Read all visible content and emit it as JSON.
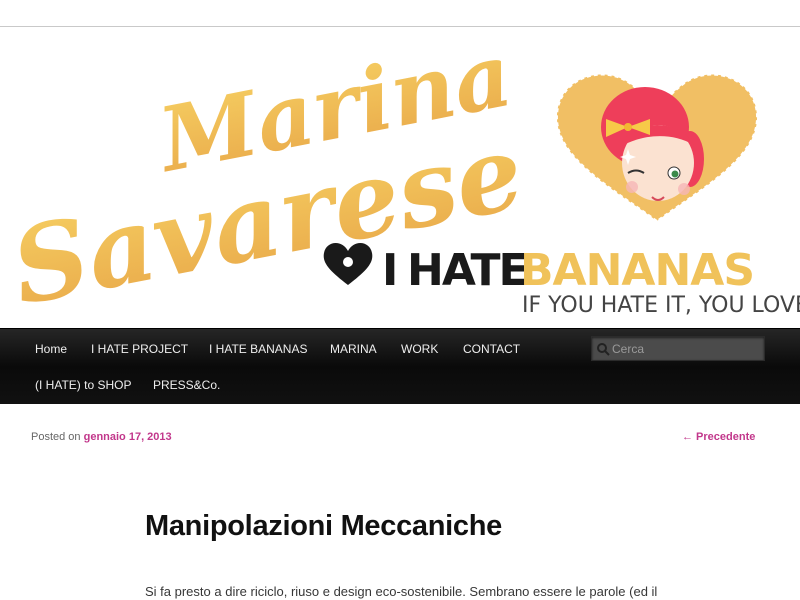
{
  "header": {
    "brand_first": "Marina",
    "brand_last": "Savarese",
    "logo_i": "I",
    "logo_hate": "HATE",
    "logo_bananas": "BANANAS",
    "tagline": "IF YOU HATE IT, YOU LOVE IT",
    "colors": {
      "brand_yellow": "#f0c25a",
      "heart_fill": "#f1bf64",
      "hair": "#ee3e5a",
      "dark": "#1a1a1a"
    }
  },
  "nav": {
    "items_row1": [
      "Home",
      "I HATE PROJECT",
      "I HATE BANANAS",
      "MARINA",
      "WORK",
      "CONTACT"
    ],
    "items_row2": [
      "(I HATE) to SHOP",
      "PRESS&Co."
    ],
    "search_placeholder": "Cerca"
  },
  "post": {
    "posted_on": "Posted on",
    "date": "gennaio 17, 2013",
    "prev_label": "← Precedente",
    "title": "Manipolazioni Meccaniche",
    "body_first_line": "Si fa presto a dire riciclo, riuso e design eco-sostenibile. Sembrano essere le parole (ed il"
  }
}
